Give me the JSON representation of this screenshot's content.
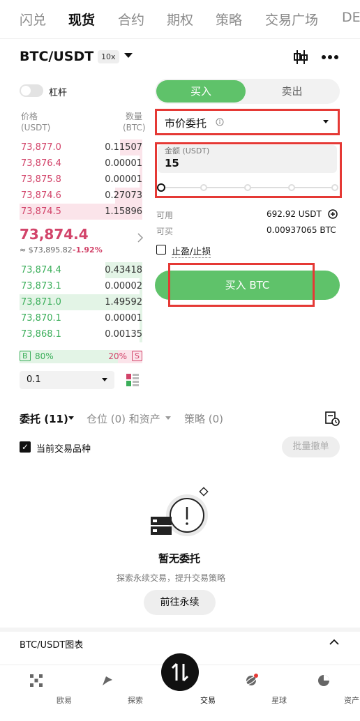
{
  "top_tabs": [
    "闪兑",
    "现货",
    "合约",
    "期权",
    "策略",
    "交易广场",
    "DE"
  ],
  "pair": {
    "name": "BTC/USDT",
    "leverage": "10x"
  },
  "leverage_toggle_label": "杠杆",
  "orderbook": {
    "price_header": "价格",
    "price_unit": "(USDT)",
    "qty_header": "数量",
    "qty_unit": "(BTC)",
    "asks": [
      {
        "price": "73,877.0",
        "qty": "0.11507",
        "depth": 0.18
      },
      {
        "price": "73,876.4",
        "qty": "0.00001",
        "depth": 0.02
      },
      {
        "price": "73,875.8",
        "qty": "0.00001",
        "depth": 0.02
      },
      {
        "price": "73,874.6",
        "qty": "0.27073",
        "depth": 0.22
      },
      {
        "price": "73,874.5",
        "qty": "1.15896",
        "depth": 1.0
      }
    ],
    "last_price": "73,874.4",
    "last_usd": "≈ $73,895.82",
    "change": "-1.92%",
    "bids": [
      {
        "price": "73,874.4",
        "qty": "0.43418",
        "depth": 0.3
      },
      {
        "price": "73,873.1",
        "qty": "0.00002",
        "depth": 0.02
      },
      {
        "price": "73,871.0",
        "qty": "1.49592",
        "depth": 1.0
      },
      {
        "price": "73,870.1",
        "qty": "0.00001",
        "depth": 0.02
      },
      {
        "price": "73,868.1",
        "qty": "0.00135",
        "depth": 0.02
      }
    ],
    "buy_ratio": "80%",
    "sell_ratio": "20%",
    "buy_badge": "B",
    "sell_badge": "S",
    "precision": "0.1"
  },
  "trade": {
    "buy_label": "买入",
    "sell_label": "卖出",
    "order_type": "市价委托",
    "amount_label": "金额 (USDT)",
    "amount_value": "15",
    "available_label": "可用",
    "available_value": "692.92 USDT",
    "can_buy_label": "可买",
    "can_buy_value": "0.00937065 BTC",
    "tpsl_label": "止盈/止损",
    "submit_label": "买入 BTC"
  },
  "orders": {
    "tab_orders": "委托 (11)",
    "tab_positions": "仓位 (0) 和资产",
    "tab_strategy": "策略 (0)",
    "current_pair_label": "当前交易品种",
    "batch_cancel": "批量撤单",
    "empty_title": "暂无委托",
    "empty_desc": "探索永续交易，提升交易策略",
    "go_button": "前往永续"
  },
  "chart_section": "BTC/USDT图表",
  "bottom_nav": [
    "欧易",
    "探索",
    "交易",
    "星球",
    "资产"
  ]
}
